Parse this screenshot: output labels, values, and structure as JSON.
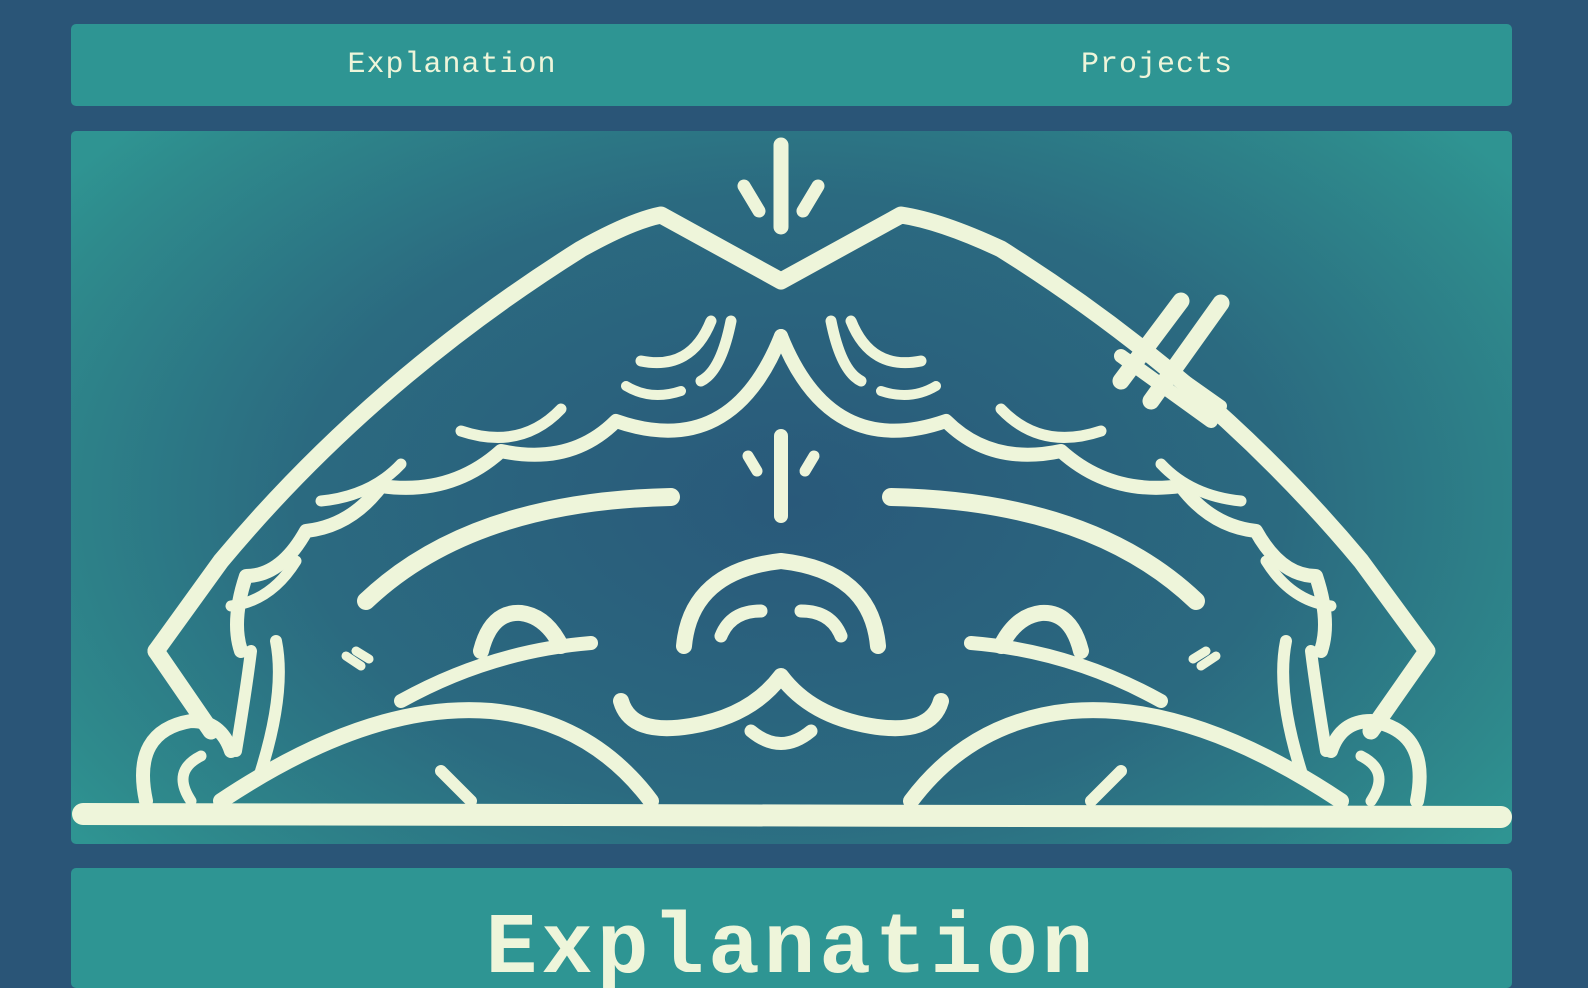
{
  "nav": {
    "items": [
      {
        "label": "Explanation"
      },
      {
        "label": "Projects"
      }
    ]
  },
  "hero": {
    "illustration": "frog-dome-emblem-illustration",
    "colors": {
      "line": "#eef5da",
      "bg_center": "#29597a",
      "bg_edge": "#2f9492"
    }
  },
  "section": {
    "title": "Explanation"
  },
  "colors": {
    "page_bg": "#2a5577",
    "panel": "#2e9593",
    "text": "#eef5da"
  }
}
